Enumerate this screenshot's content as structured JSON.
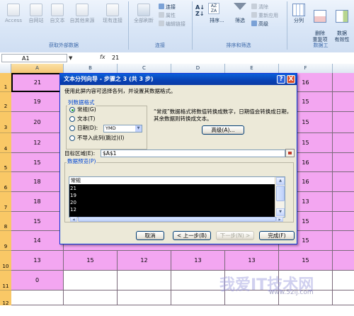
{
  "ribbon": {
    "get_external": {
      "buttons": [
        "Access",
        "自网站",
        "自文本",
        "自其他来源",
        "现有连接"
      ],
      "group_label": "获取外部数据"
    },
    "connections": {
      "refresh_label": "全部刷新",
      "items": [
        "连接",
        "属性",
        "编辑链接"
      ],
      "group_label": "连接"
    },
    "sort_filter": {
      "sort_label": "排序...",
      "filter_label": "筛选",
      "items": [
        "清除",
        "重新应用",
        "高级"
      ],
      "group_label": "排序和筛选"
    },
    "data_tools": {
      "split_label": "分列",
      "remove_dup_label": "删除\n重复项",
      "validation_label": "数据\n有效性",
      "group_label": "数据工"
    }
  },
  "formula_bar": {
    "name_box": "A1",
    "fx": "fx",
    "formula": "21"
  },
  "grid": {
    "columns": [
      "A",
      "B",
      "C",
      "D",
      "E",
      "F"
    ],
    "rows": [
      {
        "num": "1",
        "a": "21",
        "f": "16"
      },
      {
        "num": "2",
        "a": "19",
        "f": "15"
      },
      {
        "num": "3",
        "a": "20",
        "f": "15"
      },
      {
        "num": "4",
        "a": "12",
        "f": "15"
      },
      {
        "num": "5",
        "a": "15",
        "f": "16"
      },
      {
        "num": "6",
        "a": "18",
        "f": "16"
      },
      {
        "num": "7",
        "a": "18",
        "f": "13"
      },
      {
        "num": "8",
        "a": "15",
        "f": "15"
      },
      {
        "num": "9",
        "a": "14",
        "f": "15"
      },
      {
        "num": "10",
        "a": "13",
        "b": "15",
        "c": "12",
        "d": "13",
        "e": "13",
        "f": "15"
      },
      {
        "num": "11",
        "a": "0"
      },
      {
        "num": "12"
      }
    ]
  },
  "dialog": {
    "title": "文本分列向导 - 步骤之 3 (共 3 步)",
    "help": "?",
    "close": "X",
    "instruction": "使用此屏内容可选择各列，并设置其数据格式。",
    "format_group_label": "列数据格式",
    "options": {
      "general": "常规(G)",
      "text": "文本(T)",
      "date": "日期(D):",
      "skip": "不导入此列(跳过)(I)"
    },
    "date_format": "YMD",
    "description": "“常规”数据格式将数值转换成数字，日期值会转换成日期，其余数据则转换成文本。",
    "advanced_button": "高级(A)...",
    "destination_label": "目标区域(E):",
    "destination_value": "$A$1",
    "preview_label": "数据预览(P)",
    "preview_header": "常规",
    "preview_rows": [
      "21",
      "19",
      "20",
      "12"
    ],
    "buttons": {
      "cancel": "取消",
      "back": "< 上一步(B)",
      "next": "下一步(N) >",
      "finish": "完成(F)"
    }
  },
  "watermark": {
    "text": "我爱IT技术网",
    "url": "www.52ij.com"
  }
}
